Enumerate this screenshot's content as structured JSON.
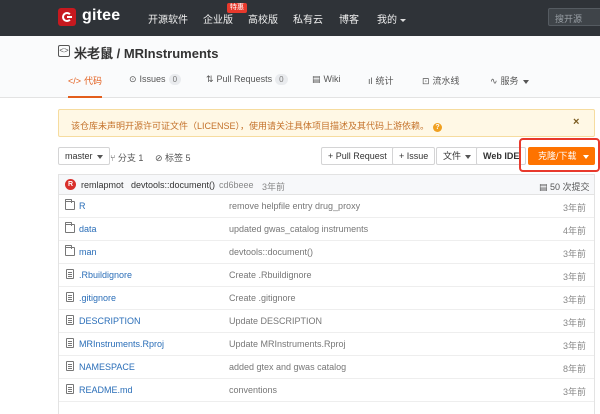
{
  "nav": {
    "brand": "gitee",
    "items": [
      "开源软件",
      "企业版",
      "高校版",
      "私有云",
      "博客",
      "我的"
    ],
    "badge": "特惠",
    "search_placeholder": "搜开源"
  },
  "repo": {
    "title": "米老鼠 / MRInstruments",
    "tabs": [
      {
        "label": "代码",
        "icon": "code-icon"
      },
      {
        "label": "Issues",
        "count": "0",
        "icon": "issue-icon"
      },
      {
        "label": "Pull Requests",
        "count": "0",
        "icon": "pull-request-icon"
      },
      {
        "label": "Wiki",
        "icon": "wiki-icon"
      },
      {
        "label": "统计",
        "icon": "stats-icon"
      },
      {
        "label": "流水线",
        "icon": "pipeline-icon"
      },
      {
        "label": "服务",
        "icon": "service-icon"
      }
    ]
  },
  "notice": {
    "text": "该仓库未声明开源许可证文件（LICENSE），使用请关注具体项目描述及其代码上游依赖。",
    "close": "×"
  },
  "toolbar": {
    "branch": "master",
    "branches": "分支 1",
    "tags": "标签 5",
    "pull_request": "+ Pull Request",
    "issue": "+ Issue",
    "file": "文件",
    "web_ide": "Web IDE",
    "clone": "克隆/下载"
  },
  "commit": {
    "avatar_letter": "R",
    "author": "remlapmot",
    "message": "devtools::document()",
    "sha": "cd6beee",
    "time": "3年前",
    "count": "50 次提交"
  },
  "files": [
    {
      "name": "R",
      "type": "folder",
      "message": "remove helpfile entry drug_proxy",
      "time": "3年前"
    },
    {
      "name": "data",
      "type": "folder",
      "message": "updated gwas_catalog instruments",
      "time": "4年前"
    },
    {
      "name": "man",
      "type": "folder",
      "message": "devtools::document()",
      "time": "3年前"
    },
    {
      "name": ".Rbuildignore",
      "type": "file",
      "message": "Create .Rbuildignore",
      "time": "3年前"
    },
    {
      "name": ".gitignore",
      "type": "file",
      "message": "Create .gitignore",
      "time": "3年前"
    },
    {
      "name": "DESCRIPTION",
      "type": "file",
      "message": "Update DESCRIPTION",
      "time": "3年前"
    },
    {
      "name": "MRInstruments.Rproj",
      "type": "file",
      "message": "Update MRInstruments.Rproj",
      "time": "3年前"
    },
    {
      "name": "NAMESPACE",
      "type": "file",
      "message": "added gtex and gwas catalog",
      "time": "8年前"
    },
    {
      "name": "README.md",
      "type": "file",
      "message": "conventions",
      "time": "3年前"
    }
  ],
  "colors": {
    "nav_bg": "#2f3338",
    "accent": "#fe7300",
    "brand_red": "#c7191f",
    "link": "#2a6eb8",
    "highlight_border": "#e8392c"
  }
}
